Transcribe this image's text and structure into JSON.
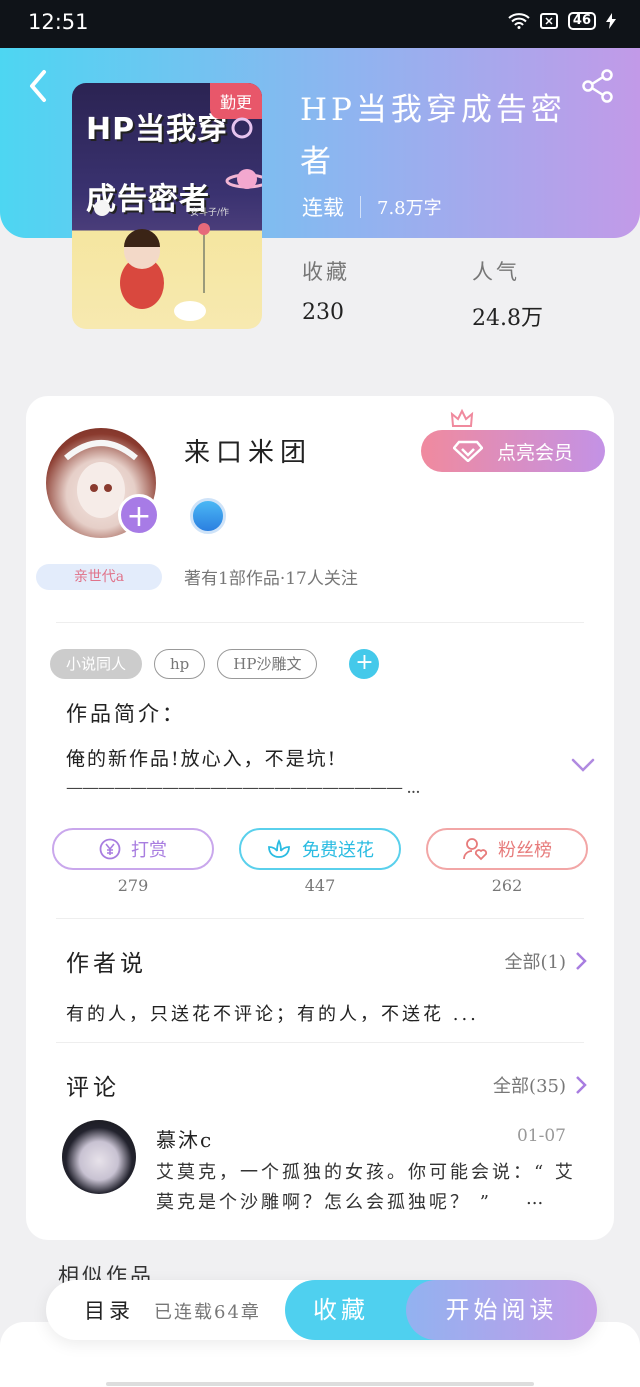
{
  "status_bar": {
    "time": "12:51",
    "battery": "46"
  },
  "book": {
    "title": "HP当我穿成告密者",
    "status": "连载",
    "word_count": "7.8万字",
    "cover_title_line1": "HP当我穿",
    "cover_title_line2": "成告密者",
    "cover_badge": "勤更",
    "cover_author": "安斗子/作",
    "stats": [
      {
        "label": "收藏",
        "value": "230"
      },
      {
        "label": "人气",
        "value": "24.8万"
      }
    ]
  },
  "author": {
    "name": "来口米团",
    "ribbon": "亲世代a",
    "stats_text": "著有1部作品·17人关注",
    "vip_button": "点亮会员"
  },
  "tags": [
    "小说同人",
    "hp",
    "HP沙雕文"
  ],
  "intro": {
    "heading": "作品简介：",
    "line1": "俺的新作品!放心入，不是坑!",
    "line2": "————————————————————— ..."
  },
  "actions": [
    {
      "label": "打赏",
      "count": "279",
      "icon": "yen-coin-icon"
    },
    {
      "label": "免费送花",
      "count": "447",
      "icon": "flower-icon"
    },
    {
      "label": "粉丝榜",
      "count": "262",
      "icon": "fan-rank-icon"
    }
  ],
  "author_says": {
    "heading": "作者说",
    "all_label": "全部(1)",
    "text": "有的人，只送花不评论；有的人，不送花 ..."
  },
  "comments": {
    "heading": "评论",
    "all_label": "全部(35)",
    "items": [
      {
        "user": "慕沐c",
        "date": "01-07",
        "text": "艾莫克，一个孤独的女孩。你可能会说：“ 艾莫克是个沙雕啊？怎么会孤独呢？ ”",
        "more": "..."
      }
    ]
  },
  "similar_heading": "相似作品",
  "bottom": {
    "toc": "目录",
    "chapters": "已连载64章",
    "favorite": "收藏",
    "read": "开始阅读"
  },
  "colors": {
    "accent_cyan": "#4fd0ef",
    "accent_purple": "#c39be8",
    "vip_pink": "#f08a9e"
  }
}
